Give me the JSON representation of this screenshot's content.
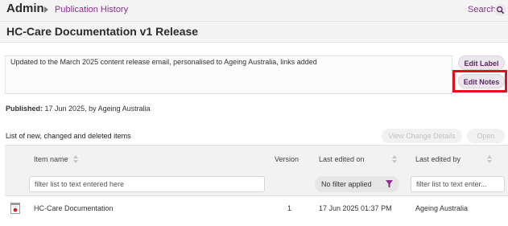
{
  "header": {
    "app_title": "Admin",
    "breadcrumb": "Publication History",
    "search_label": "Search"
  },
  "page": {
    "title": "HC-Care Documentation v1 Release"
  },
  "notes": {
    "text": "Updated to the March 2025 content release email, personalised to Ageing Australia, links added",
    "edit_label_button": "Edit Label",
    "edit_notes_button": "Edit Notes"
  },
  "published": {
    "label": "Published:",
    "value": "17 Jun 2025, by Ageing Australia"
  },
  "list": {
    "title": "List of new, changed and deleted items",
    "view_change_button": "View Change Details",
    "open_button": "Open"
  },
  "table": {
    "columns": {
      "item_name": "Item name",
      "version": "Version",
      "last_edited_on": "Last edited on",
      "last_edited_by": "Last edited by"
    },
    "filters": {
      "item_name_placeholder": "filter list to text entered here",
      "last_edited_on": "No filter applied",
      "last_edited_by_placeholder": "filter list to text enter..."
    },
    "rows": [
      {
        "item_name": "HC-Care Documentation",
        "version": "1",
        "last_edited_on": "17 Jun 2025 01:37 PM",
        "last_edited_by": "Ageing Australia"
      }
    ]
  },
  "colors": {
    "accent": "#8a2f8e",
    "highlight": "#e01020"
  }
}
